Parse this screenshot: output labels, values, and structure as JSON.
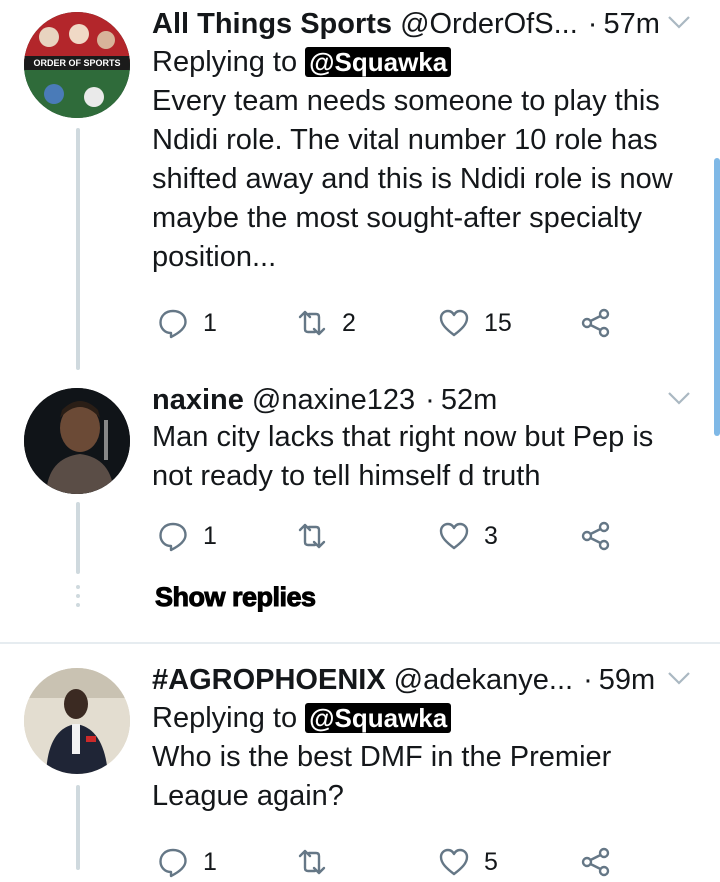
{
  "tweets": [
    {
      "name": "All Things Sports",
      "handle": "@OrderOfS...",
      "time": "57m",
      "reply_prefix": "Replying to",
      "reply_mention": "@Squawka",
      "text_lines": [
        "Every team needs someone to play this",
        "Ndidi role. The vital number 10 role has",
        "shifted away and this is Ndidi role is now",
        "maybe the most sought-after specialty",
        "position..."
      ],
      "replies": "1",
      "retweets": "2",
      "likes": "15",
      "avatar_label": "ORDER OF SPORTS"
    },
    {
      "name": "naxine",
      "handle": "@naxine123",
      "time": "52m",
      "text_lines": [
        "Man city lacks that right now but Pep is",
        "not ready to tell himself d truth"
      ],
      "replies": "1",
      "retweets": "",
      "likes": "3"
    },
    {
      "name": "#AGROPHOENIX",
      "handle": "@adekanye...",
      "time": "59m",
      "reply_prefix": "Replying to",
      "reply_mention": "@Squawka",
      "text_lines": [
        "Who is the best DMF in the Premier",
        "League again?"
      ],
      "replies": "1",
      "retweets": "",
      "likes": "5"
    }
  ],
  "show_replies": "Show replies",
  "colors": {
    "icon": "#657786",
    "line": "#cfd9de",
    "accent": "#1da1f2"
  },
  "icons": [
    "reply-icon",
    "retweet-icon",
    "like-icon",
    "share-icon",
    "chevron-down-icon"
  ]
}
